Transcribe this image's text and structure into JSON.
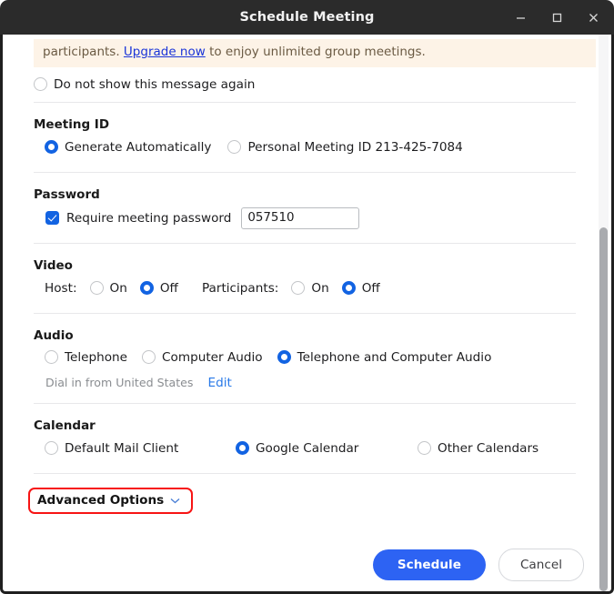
{
  "window": {
    "title": "Schedule Meeting",
    "controls": [
      {
        "name": "minimize",
        "glyph": "–"
      },
      {
        "name": "maximize",
        "glyph": "❑"
      },
      {
        "name": "close",
        "glyph": "×"
      }
    ]
  },
  "banner": {
    "text_before": "participants. ",
    "link": "Upgrade now",
    "text_after": " to enjoy unlimited group meetings."
  },
  "dismiss": {
    "label": "Do not show this message again",
    "checked": false
  },
  "meeting_id": {
    "title": "Meeting ID",
    "options": [
      {
        "label": "Generate Automatically",
        "checked": true
      },
      {
        "label": "Personal Meeting ID 213-425-7084",
        "checked": false
      }
    ]
  },
  "password": {
    "title": "Password",
    "require_label": "Require meeting password",
    "require_checked": true,
    "value": "057510",
    "placeholder": ""
  },
  "video": {
    "title": "Video",
    "host_label": "Host:",
    "host_options": [
      {
        "label": "On",
        "checked": false
      },
      {
        "label": "Off",
        "checked": true
      }
    ],
    "participants_label": "Participants:",
    "participants_options": [
      {
        "label": "On",
        "checked": false
      },
      {
        "label": "Off",
        "checked": true
      }
    ]
  },
  "audio": {
    "title": "Audio",
    "options": [
      {
        "label": "Telephone",
        "checked": false
      },
      {
        "label": "Computer Audio",
        "checked": false
      },
      {
        "label": "Telephone and Computer Audio",
        "checked": true
      }
    ],
    "dial_in_text": "Dial in from United States",
    "edit_link": "Edit"
  },
  "calendar": {
    "title": "Calendar",
    "options": [
      {
        "label": "Default Mail Client",
        "checked": false
      },
      {
        "label": "Google Calendar",
        "checked": true
      },
      {
        "label": "Other Calendars",
        "checked": false
      }
    ]
  },
  "advanced": {
    "label": "Advanced Options",
    "chevron": "⌄",
    "highlight_color": "#f71414"
  },
  "footer": {
    "primary": "Schedule",
    "secondary": "Cancel"
  },
  "colors": {
    "accent": "#1263e2",
    "primary_button": "#2d63f3",
    "link": "#2a7ae8",
    "banner_bg": "#fdf3e7",
    "titlebar_bg": "#2b2b2b"
  }
}
